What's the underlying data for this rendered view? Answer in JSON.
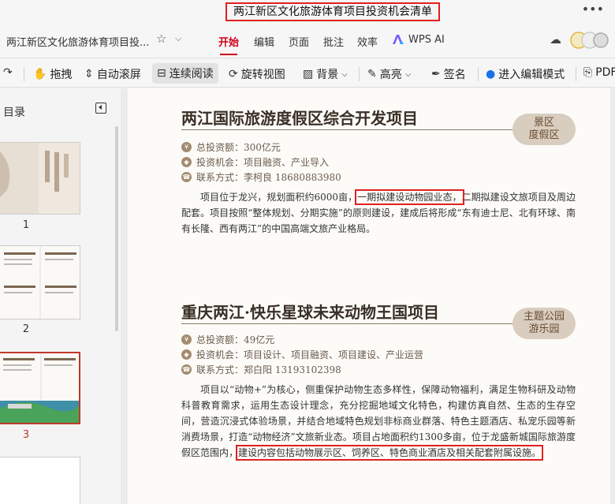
{
  "window": {
    "title": "两江新区文化旅游体育项目投资机会清单",
    "more": "•••"
  },
  "tabbar": {
    "doc_tab": "两江新区文化旅游体育项目投...",
    "menus": [
      "开始",
      "编辑",
      "页面",
      "批注",
      "效率"
    ],
    "ai_label": "WPS AI"
  },
  "toolbar": {
    "items": [
      "拖拽",
      "自动滚屏",
      "连续阅读",
      "旋转视图",
      "背景",
      "高亮",
      "签名",
      "进入编辑模式",
      "PDF"
    ]
  },
  "sidebar": {
    "title": "目录",
    "pages": [
      "1",
      "2",
      "3"
    ],
    "current_page": "3"
  },
  "document": {
    "project1": {
      "title": "两江国际旅游度假区综合开发项目",
      "badge_line1": "景区",
      "badge_line2": "度假区",
      "investment": "总投资额：300亿元",
      "opportunity": "投资机会：项目融资、产业导入",
      "contact": "联系方式：李柯良  18680883980",
      "p1": "项目位于龙兴，规划面积约6000亩，",
      "p_hl": "一期拟建设动物园业态，",
      "p2": "二期拟建设文旅项目及周边配套。项目按照“整体规划、分期实施”的原则建设，建成后将形成“东有迪士尼、北有环球、南有长隆、西有两江”的中国高端文旅产业格局。"
    },
    "project2": {
      "title": "重庆两江·快乐星球未来动物王国项目",
      "badge_line1": "主题公园",
      "badge_line2": "游乐园",
      "investment": "总投资额：49亿元",
      "opportunity": "投资机会：项目设计、项目融资、项目建设、产业运营",
      "contact": "联系方式：郑白阳  13193102398",
      "p1": "项目以“动物+”为核心，侧重保护动物生态多样性，保障动物福利，满足生物科研及动物科普教育需求，运用生态设计理念，充分挖掘地域文化特色，构建仿真自然、生态的生存空间，营造沉浸式体验场景，并结合地域特色规划非标商业群落、特色主题酒店、私宠乐园等新消费场景，打造“动物经济”文旅新业态。项目占地面积约1300多亩，位于龙盛新城国际旅游度假区范围内，",
      "p_hl": "建设内容包括动物展示区、饲养区、特色商业酒店及相关配套附属设施。"
    }
  }
}
